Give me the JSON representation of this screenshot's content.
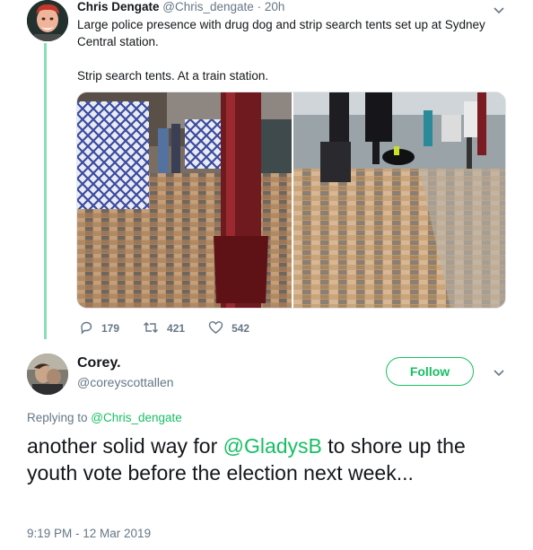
{
  "tweet1": {
    "name": "Chris Dengate",
    "handle": "@Chris_dengate",
    "separator": " · ",
    "time": "20h",
    "text": "Large police presence with drug dog and strip search tents set up at Sydney Central station.\n\nStrip search tents. At a train station.",
    "media_left_alt": "station-platform-barriers-and-pillar-photo",
    "media_right_alt": "police-with-drug-dog-photo",
    "actions": {
      "reply_count": "179",
      "retweet_count": "421",
      "like_count": "542"
    }
  },
  "tweet2": {
    "name": "Corey.",
    "handle": "@coreyscottallen",
    "follow_label": "Follow",
    "replying_prefix": "Replying to ",
    "replying_handle": "@Chris_dengate",
    "text_before": "another solid way for ",
    "text_mention": "@GladysB",
    "text_after": " to shore up the youth vote before the election next week...",
    "timestamp": "9:19 PM - 12 Mar 2019"
  },
  "colors": {
    "accent": "#17bf63",
    "thread_line": "#87e1b5",
    "secondary_text": "#657786",
    "primary_text": "#14171a"
  }
}
